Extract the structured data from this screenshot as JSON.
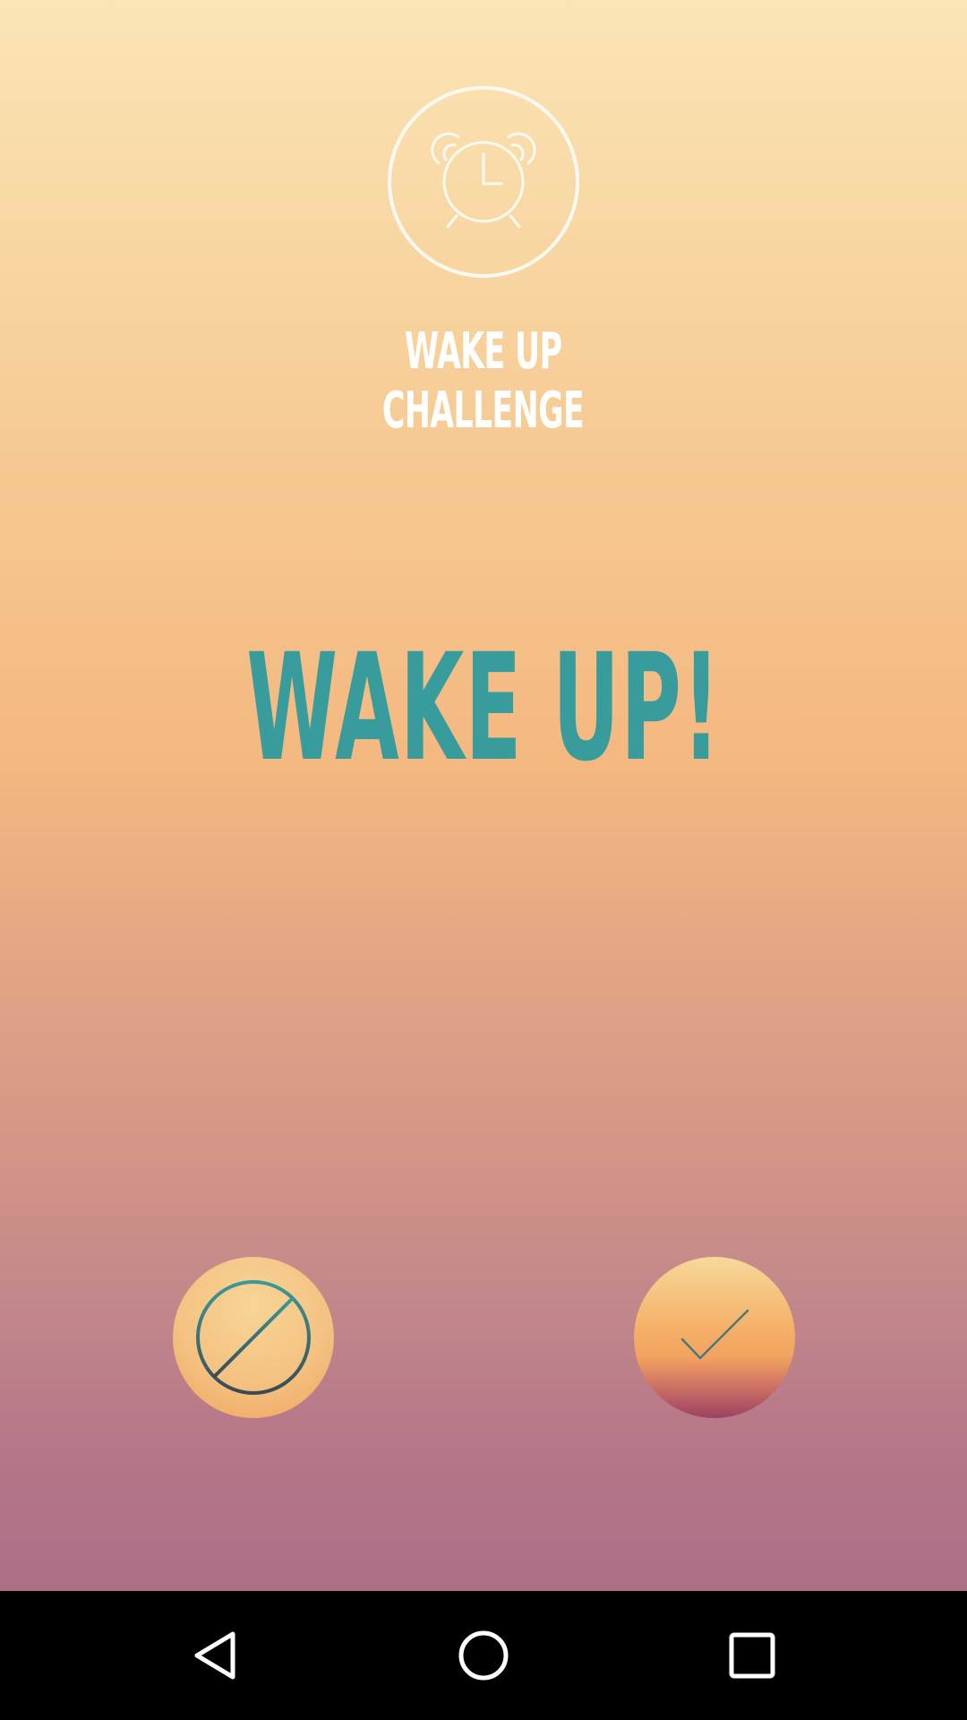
{
  "app": {
    "title_line1": "WAKE UP",
    "title_line2": "CHALLENGE",
    "alarm_icon": "alarm-clock-icon"
  },
  "main": {
    "headline": "WAKE UP!"
  },
  "actions": {
    "dismiss_icon": "prohibited-icon",
    "accept_icon": "checkmark-icon"
  },
  "navbar": {
    "back_icon": "back-triangle-icon",
    "home_icon": "home-circle-icon",
    "recent_icon": "recent-apps-square-icon"
  },
  "colors": {
    "background_top": "#fae5b5",
    "background_mid": "#f4b880",
    "background_bottom": "#ad6f88",
    "headline": "#399c9c",
    "title": "#ffffff",
    "navbar": "#000000"
  }
}
